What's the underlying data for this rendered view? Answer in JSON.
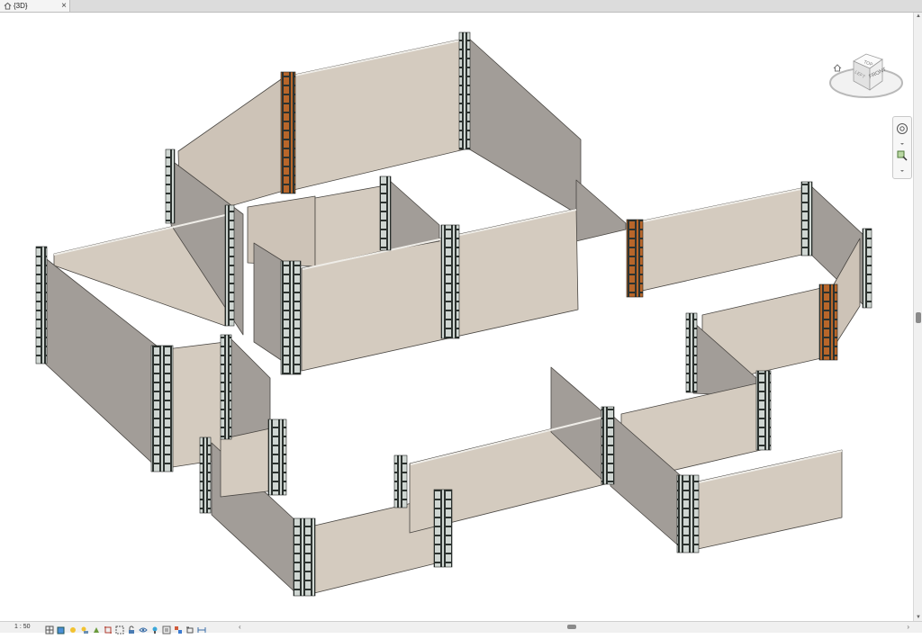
{
  "tab": {
    "label": "{3D}",
    "close": "×"
  },
  "viewcube": {
    "top_label": "TOP",
    "front_label": "FRONT",
    "left_label": "LEFT"
  },
  "status": {
    "scale": "1 : 50"
  },
  "colors": {
    "wall_face": "#d4cbbf",
    "wall_side": "#a29d98",
    "wall_top": "#efede8",
    "form_frame": "#cfd6d2",
    "form_dark": "#2d3330",
    "timber": "#b8662a",
    "background": "#ffffff"
  },
  "status_icons": [
    "detail-level-icon",
    "visual-style-icon",
    "sun-path-icon",
    "shadows-icon",
    "rendering-icon",
    "crop-view-icon",
    "show-crop-icon",
    "unlock-3d-icon",
    "temporary-hide-icon",
    "reveal-hidden-icon",
    "temporary-view-props-icon",
    "show-analytical-icon",
    "highlight-displacement-icon",
    "constraints-icon"
  ]
}
